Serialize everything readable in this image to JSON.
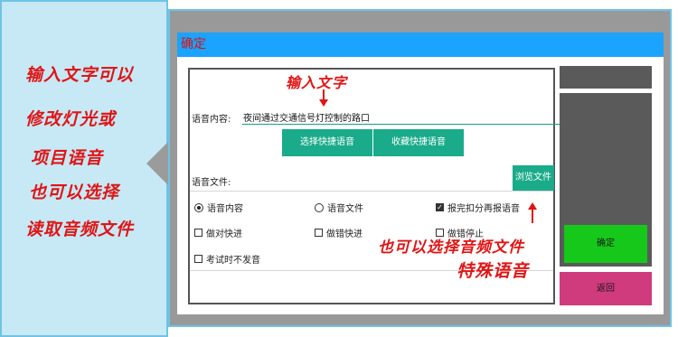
{
  "annotations": {
    "left_notes": [
      "输入文字可以",
      "修改灯光或",
      "项目语音",
      "也可以选择",
      "读取音频文件"
    ],
    "input_note": "输入文字",
    "file_note_line1": "也可以选择音频文件",
    "file_note_line2": "特殊语音"
  },
  "dialog": {
    "title": "确定",
    "voice_content_label": "语音内容:",
    "voice_content_value": "夜间通过交通信号灯控制的路口",
    "select_quick_voice": "选择快捷语音",
    "save_quick_voice": "收藏快捷语音",
    "voice_file_label": "语音文件:",
    "browse_file": "浏览文件",
    "options": {
      "voice_content_radio": "语音内容",
      "voice_file_radio": "语音文件",
      "report_then_voice": "报完扣分再报语音",
      "fast_when_right": "做对快进",
      "fast_when_wrong": "做错快进",
      "stop_when_wrong": "做错停止",
      "silent_in_exam": "考试时不发音"
    },
    "state": {
      "voice_mode": "voice_content",
      "report_then_voice": true,
      "fast_when_right": false,
      "fast_when_wrong": false,
      "stop_when_wrong": false,
      "silent_in_exam": false
    }
  },
  "side": {
    "confirm": "确定",
    "back": "返回"
  }
}
